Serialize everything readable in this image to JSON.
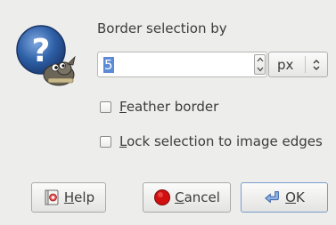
{
  "dialog": {
    "title": "Border selection by",
    "border_value": "5",
    "unit": "px",
    "feather": {
      "prefix": "",
      "mnemonic": "F",
      "rest": "eather border",
      "checked": false
    },
    "lock": {
      "prefix": "",
      "mnemonic": "L",
      "rest": "ock selection to image edges",
      "checked": false
    }
  },
  "buttons": {
    "help": {
      "mnemonic": "H",
      "rest": "elp"
    },
    "cancel": {
      "mnemonic": "C",
      "rest": "ancel"
    },
    "ok": {
      "mnemonic": "O",
      "rest": "K"
    }
  },
  "icons": {
    "dialog_icon": "question-wilber-icon",
    "spin_up": "arrow-up-icon",
    "spin_down": "arrow-down-icon",
    "unit_chevron": "updown-chevron-icon",
    "help": "help-book-icon",
    "cancel": "stop-icon",
    "ok": "ok-arrow-icon"
  },
  "colors": {
    "selection": "#5b8bd6",
    "question_blue": "#2e5fa6",
    "cancel_red": "#d10f0f"
  }
}
